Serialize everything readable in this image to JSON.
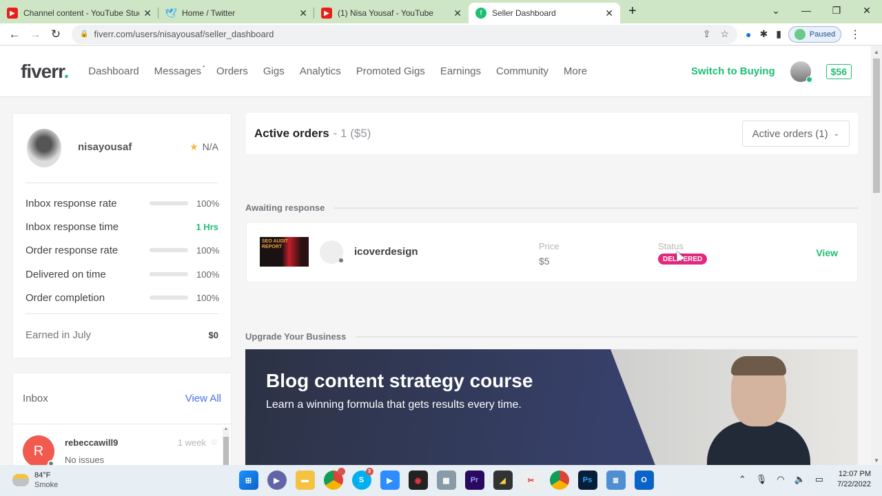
{
  "browser": {
    "tabs": [
      {
        "title": "Channel content - YouTube Stud",
        "icon": "youtube-icon",
        "active": false
      },
      {
        "title": "Home / Twitter",
        "icon": "twitter-icon",
        "active": false
      },
      {
        "title": "(1) Nisa Yousaf - YouTube",
        "icon": "youtube-icon",
        "active": false
      },
      {
        "title": "Seller Dashboard",
        "icon": "fiverr-icon",
        "active": true
      }
    ],
    "url": "fiverr.com/users/nisayousaf/seller_dashboard",
    "profile_status": "Paused"
  },
  "header": {
    "logo": "fiverr",
    "logo_dot": ".",
    "nav": [
      "Dashboard",
      "Messages",
      "Orders",
      "Gigs",
      "Analytics",
      "Promoted Gigs",
      "Earnings",
      "Community",
      "More"
    ],
    "messages_marker": "•",
    "switch_label": "Switch to Buying",
    "balance": "$56"
  },
  "profile": {
    "username": "nisayousaf",
    "rating": "N/A",
    "stats": [
      {
        "label": "Inbox response rate",
        "value": "100%",
        "progress": 1.0
      },
      {
        "label": "Inbox response time",
        "value": "1 Hrs"
      },
      {
        "label": "Order response rate",
        "value": "100%",
        "progress": 1.0
      },
      {
        "label": "Delivered on time",
        "value": "100%",
        "progress": 1.0
      },
      {
        "label": "Order completion",
        "value": "100%",
        "progress": 1.0
      }
    ],
    "earned_label": "Earned in July",
    "earned_value": "$0"
  },
  "inbox": {
    "title": "Inbox",
    "view_all": "View All",
    "messages": [
      {
        "initial": "R",
        "sender": "rebeccawill9",
        "time": "1 week",
        "preview": "No issues"
      }
    ]
  },
  "orders": {
    "title": "Active orders",
    "summary": "- 1 ($5)",
    "filter": "Active orders (1)",
    "section_awaiting": "Awaiting response",
    "items": [
      {
        "thumb_text": "SEO AUDIT REPORT",
        "buyer": "icoverdesign",
        "price_label": "Price",
        "price": "$5",
        "status_label": "Status",
        "status": "DELIVERED",
        "action": "View"
      }
    ]
  },
  "upgrade": {
    "section": "Upgrade Your Business",
    "banner_title": "Blog content strategy course",
    "banner_subtitle": "Learn a winning formula that gets results every time."
  },
  "taskbar": {
    "temp": "84°F",
    "weather": "Smoke",
    "time": "12:07 PM",
    "date": "7/22/2022",
    "apps": [
      "Start",
      "Teams",
      "File Explorer",
      "Chrome",
      "Skype",
      "Zoom",
      "Camera",
      "Calculator",
      "Premiere Pro",
      "Sticky Notes",
      "Snipping Tool",
      "Chrome",
      "Photoshop",
      "Notepad",
      "Outlook"
    ],
    "skype_badge": "3"
  },
  "colors": {
    "brand_green": "#1dbf73",
    "status_pink": "#e4287e",
    "link_blue": "#446ee7"
  }
}
